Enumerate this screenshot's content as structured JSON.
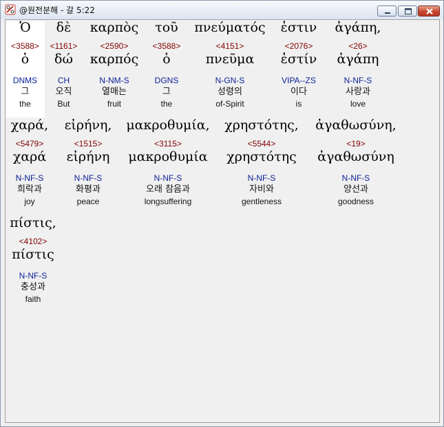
{
  "window": {
    "title": "@원전분해 - 갈 5:22",
    "icon": "app-icon"
  },
  "lines": [
    [
      {
        "greek": "Ὁ",
        "strong": "<3588>",
        "lemma": "ὁ",
        "parse": "DNMS",
        "korean": "그",
        "english": "the"
      },
      {
        "greek": "δὲ",
        "strong": "<1161>",
        "lemma": "δώ",
        "parse": "CH",
        "korean": "오직",
        "english": "But"
      },
      {
        "greek": "καρπὸς",
        "strong": "<2590>",
        "lemma": "καρπός",
        "parse": "N-NM-S",
        "korean": "열매는",
        "english": "fruit"
      },
      {
        "greek": "τοῦ",
        "strong": "<3588>",
        "lemma": "ὁ",
        "parse": "DGNS",
        "korean": "그",
        "english": "the"
      },
      {
        "greek": "πνεύματός",
        "strong": "<4151>",
        "lemma": "πνεῦμα",
        "parse": "N-GN-S",
        "korean": "성령의",
        "english": "of-Spirit"
      },
      {
        "greek": "ἐστιν",
        "strong": "<2076>",
        "lemma": "ἐστίν",
        "parse": "VIPA--ZS",
        "korean": "이다",
        "english": "is"
      },
      {
        "greek": "ἀγάπη,",
        "strong": "<26>",
        "lemma": "ἀγάπη",
        "parse": "N-NF-S",
        "korean": "사랑과",
        "english": "love"
      }
    ],
    [
      {
        "greek": "χαρά,",
        "strong": "<5479>",
        "lemma": "χαρά",
        "parse": "N-NF-S",
        "korean": "희락과",
        "english": "joy"
      },
      {
        "greek": "εἰρήνη,",
        "strong": "<1515>",
        "lemma": "εἰρήνη",
        "parse": "N-NF-S",
        "korean": "화평과",
        "english": "peace"
      },
      {
        "greek": "μακροθυμία,",
        "strong": "<3115>",
        "lemma": "μακροθυμία",
        "parse": "N-NF-S",
        "korean": "오래 참음과",
        "english": "longsuffering"
      },
      {
        "greek": "χρηστότης,",
        "strong": "<5544>",
        "lemma": "χρηστότης",
        "parse": "N-NF-S",
        "korean": "자비와",
        "english": "gentleness"
      },
      {
        "greek": "ἀγαθωσύνη,",
        "strong": "<19>",
        "lemma": "ἀγαθωσύνη",
        "parse": "N-NF-S",
        "korean": "양선과",
        "english": "goodness"
      }
    ],
    [
      {
        "greek": "πίστις,",
        "strong": "<4102>",
        "lemma": "πίστις",
        "parse": "N-NF-S",
        "korean": "충성과",
        "english": "faith"
      }
    ]
  ]
}
